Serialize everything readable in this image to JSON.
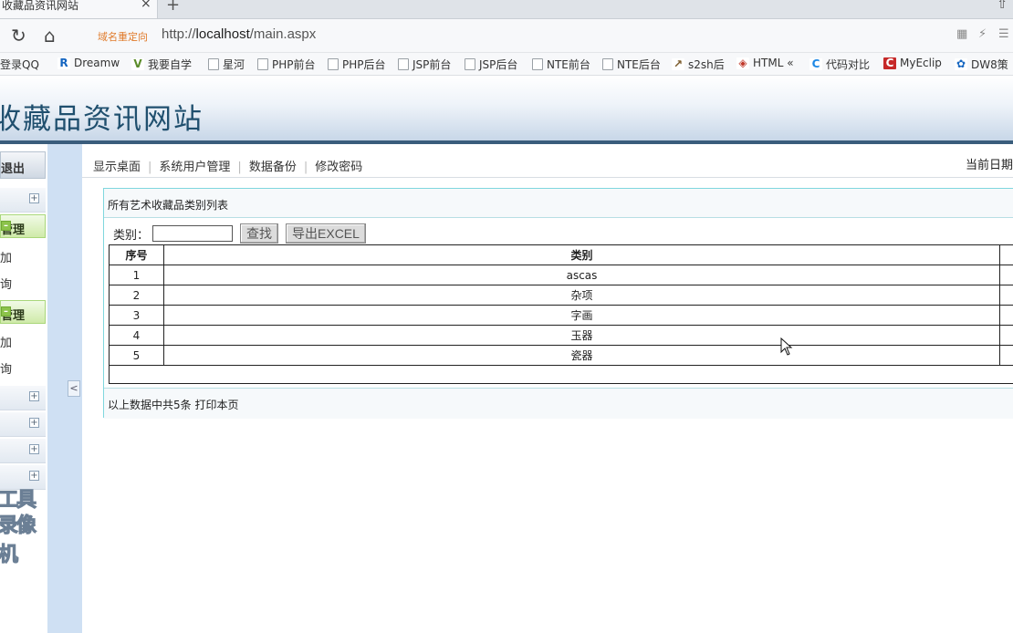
{
  "browser": {
    "tab_title": "收藏品资讯网站",
    "tab_close": "×",
    "new_tab": "+",
    "redirect_label": "域名重定向",
    "url_prefix": "http://",
    "url_host": "localhost",
    "url_path": "/main.aspx",
    "bookmarks": [
      "登录QQ",
      "Dreamw",
      "我要自学",
      "星河",
      "PHP前台",
      "PHP后台",
      "JSP前台",
      "JSP后台",
      "NTE前台",
      "NTE后台",
      "s2sh后",
      "HTML «",
      "代码对比",
      "MyEclip",
      "DW8策"
    ]
  },
  "site": {
    "title": "收藏品资讯网站"
  },
  "sidebar": {
    "exit_label": "退出",
    "group1": {
      "label": "管理",
      "items": [
        "加",
        "询"
      ]
    },
    "group2": {
      "label": "管理",
      "items": [
        "加",
        "询"
      ]
    },
    "deco_line1": "工具",
    "deco_line2": "录像机",
    "collapse": "<"
  },
  "topnav": {
    "links": [
      "显示桌面",
      "系统用户管理",
      "数据备份",
      "修改密码"
    ],
    "date_label": "当前日期"
  },
  "panel": {
    "title": "所有艺术收藏品类别列表",
    "search_label": "类别：",
    "search_value": "",
    "search_button": "查找",
    "export_button": "导出EXCEL",
    "columns": [
      "序号",
      "类别"
    ],
    "rows": [
      [
        "1",
        "ascas"
      ],
      [
        "2",
        "杂项"
      ],
      [
        "3",
        "字画"
      ],
      [
        "4",
        "玉器"
      ],
      [
        "5",
        "瓷器"
      ]
    ],
    "footer_text": "以上数据中共5条 打印本页"
  }
}
